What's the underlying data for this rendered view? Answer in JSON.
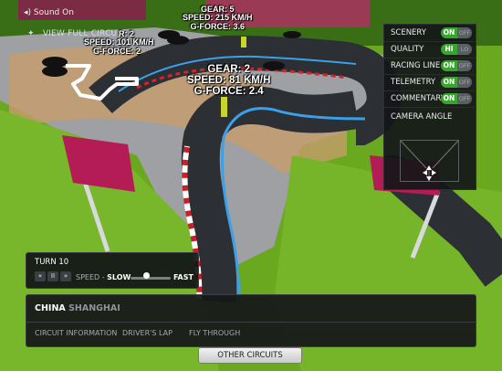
{
  "sound": {
    "label": "Sound On"
  },
  "view_full": {
    "label": "VIEW FULL CIRCUIT"
  },
  "callouts": {
    "top": {
      "gear": "GEAR: 5",
      "speed": "SPEED: 215 KM/H",
      "gforce": "G-FORCE: 3.6"
    },
    "left": {
      "gear": "R: 2",
      "speed": "SPEED: 101 KM/H",
      "gforce": "G-FORCE: 2"
    },
    "main": {
      "gear": "GEAR: 2",
      "speed": "SPEED: 81 KM/H",
      "gforce": "G-FORCE: 2.4"
    }
  },
  "settings": {
    "rows": [
      {
        "label": "SCENERY",
        "on": "ON",
        "off": "OFF"
      },
      {
        "label": "QUALITY",
        "on": "HI",
        "off": "LO"
      },
      {
        "label": "RACING LINE",
        "on": "ON",
        "off": "OFF"
      },
      {
        "label": "TELEMETRY",
        "on": "ON",
        "off": "OFF"
      },
      {
        "label": "COMMENTARY",
        "on": "ON",
        "off": "OFF"
      }
    ],
    "camera_label": "CAMERA ANGLE"
  },
  "player": {
    "turn": "TURN 10",
    "prev": "«",
    "pause": "II",
    "next": "»",
    "speed_prefix": "SPEED -",
    "speed_value": "SLOW",
    "fast": "FAST",
    "speed_level": 0.4
  },
  "info": {
    "country": "CHINA",
    "city": "SHANGHAI",
    "tabs": [
      "CIRCUIT INFORMATION",
      "DRIVER'S LAP",
      "FLY THROUGH"
    ]
  },
  "other_circuits": "OTHER CIRCUITS"
}
